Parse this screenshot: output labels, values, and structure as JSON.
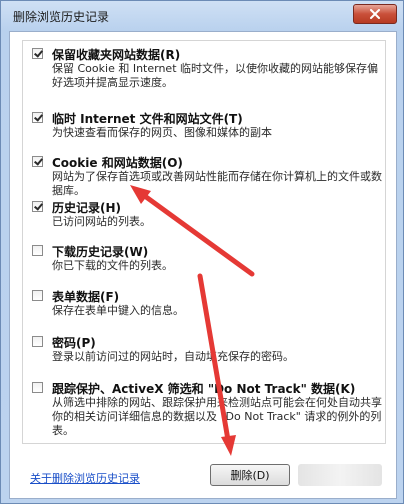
{
  "window": {
    "title": "删除浏览历史记录"
  },
  "options": [
    {
      "title": "保留收藏夹网站数据(R)",
      "desc": "保留 Cookie 和 Internet 临时文件，以使你收藏的网站能够保存偏好选项并提高显示速度。",
      "checked": true
    },
    {
      "title": "临时 Internet 文件和网站文件(T)",
      "desc": "为快速查看而保存的网页、图像和媒体的副本",
      "checked": true
    },
    {
      "title": "Cookie 和网站数据(O)",
      "desc": "网站为了保存首选项或改善网站性能而存储在你计算机上的文件或数据库。",
      "checked": true
    },
    {
      "title": "历史记录(H)",
      "desc": "已访问网站的列表。",
      "checked": true
    },
    {
      "title": "下载历史记录(W)",
      "desc": "你已下载的文件的列表。",
      "checked": false
    },
    {
      "title": "表单数据(F)",
      "desc": "保存在表单中键入的信息。",
      "checked": false
    },
    {
      "title": "密码(P)",
      "desc": "登录以前访问过的网站时，自动填充保存的密码。",
      "checked": false
    },
    {
      "title": "跟踪保护、ActiveX 筛选和 \"Do Not Track\" 数据(K)",
      "desc": "从筛选中排除的网站、跟踪保护用来检测站点可能会在何处自动共享你的相关访问详细信息的数据以及 \"Do Not Track\" 请求的例外的列表。",
      "checked": false
    }
  ],
  "footer": {
    "about_link": "关于删除浏览历史记录",
    "delete_label": "删除(D)"
  },
  "colors": {
    "annotation_arrow": "#e53935",
    "link": "#1a4fc8"
  },
  "icons": {
    "close": "close-icon",
    "annotation": "red-arrow"
  }
}
